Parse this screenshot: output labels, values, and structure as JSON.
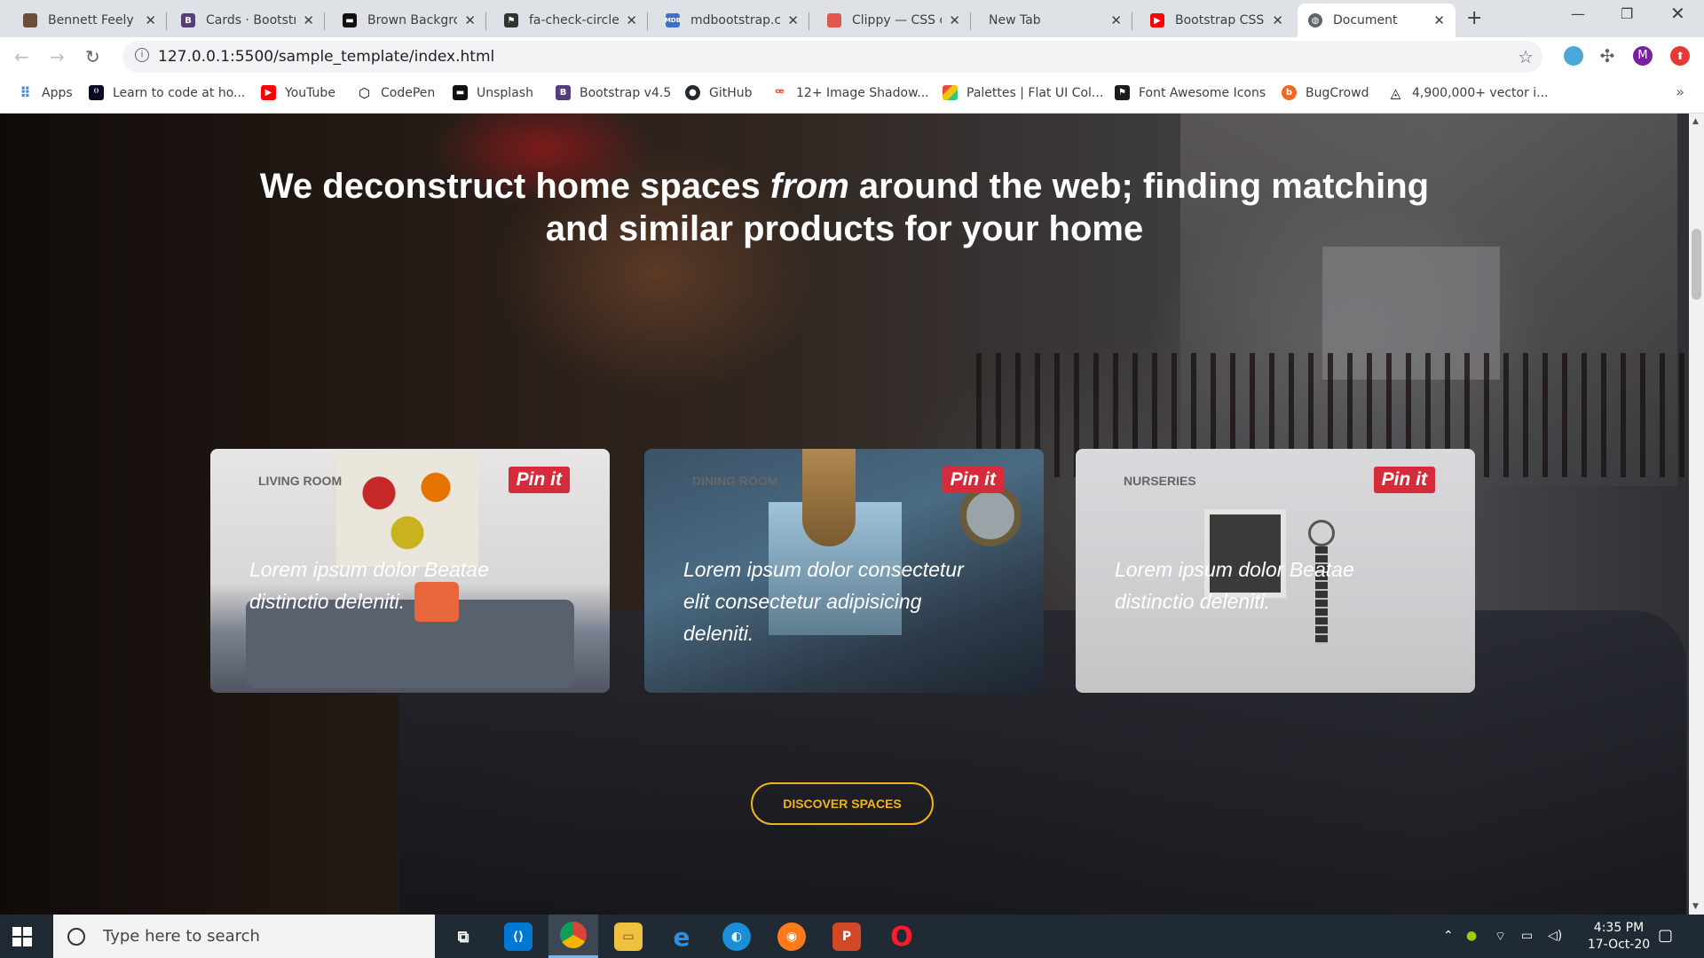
{
  "browser": {
    "tabs": [
      {
        "title": "Bennett Feely",
        "favicon_color": "#6b4f3a"
      },
      {
        "title": "Cards · Bootstra",
        "favicon_color": "#563d7c"
      },
      {
        "title": "Brown Backgro",
        "favicon_color": "#111111"
      },
      {
        "title": "fa-check-circle",
        "favicon_color": "#333333"
      },
      {
        "title": "mdbootstrap.co",
        "favicon_color": "#3b71ca"
      },
      {
        "title": "Clippy — CSS c",
        "favicon_color": "#e2574c"
      },
      {
        "title": "New Tab",
        "favicon_color": ""
      },
      {
        "title": "Bootstrap CSS",
        "favicon_color": "#ff0000"
      },
      {
        "title": "Document",
        "favicon_color": "#5f6368"
      }
    ],
    "active_tab_index": 8,
    "url": "127.0.0.1:5500/sample_template/index.html",
    "profile_initial": "M",
    "bookmarks": [
      {
        "label": "Apps",
        "icon": "apps-grid-icon",
        "color": "#4285f4"
      },
      {
        "label": "Learn to code at ho...",
        "icon": "freecodecamp-icon",
        "color": "#0a0a23"
      },
      {
        "label": "YouTube",
        "icon": "youtube-icon",
        "color": "#ff0000"
      },
      {
        "label": "CodePen",
        "icon": "codepen-icon",
        "color": "#000000"
      },
      {
        "label": "Unsplash",
        "icon": "unsplash-icon",
        "color": "#111111"
      },
      {
        "label": "Bootstrap v4.5",
        "icon": "bootstrap-icon",
        "color": "#563d7c"
      },
      {
        "label": "GitHub",
        "icon": "github-icon",
        "color": "#24292e"
      },
      {
        "label": "12+ Image Shadow...",
        "icon": "image-shadow-icon",
        "color": "#e44d26"
      },
      {
        "label": "Palettes | Flat UI Col...",
        "icon": "palette-icon",
        "color": "#f1c40f"
      },
      {
        "label": "Font Awesome Icons",
        "icon": "font-awesome-icon",
        "color": "#1c1c1c"
      },
      {
        "label": "BugCrowd",
        "icon": "bugcrowd-icon",
        "color": "#f26822"
      },
      {
        "label": "4,900,000+ vector i...",
        "icon": "vector-icon",
        "color": "#111111"
      }
    ]
  },
  "page": {
    "hero": {
      "line1_a": "We deconstruct home spaces ",
      "line1_em": "from",
      "line1_b": " around the web; finding matching",
      "line2": "and similar products for your home"
    },
    "cards": [
      {
        "category": "LIVING ROOM",
        "pin_label": "Pin it",
        "description": "Lorem ipsum dolor Beatae distinctio deleniti."
      },
      {
        "category": "DINING ROOM",
        "pin_label": "Pin it",
        "description": "Lorem ipsum dolor consectetur elit consectetur adipisicing deleniti."
      },
      {
        "category": "NURSERIES",
        "pin_label": "Pin it",
        "description": "Lorem ipsum dolor Beatae distinctio deleniti."
      }
    ],
    "cta": {
      "label": "DISCOVER SPACES"
    },
    "accent_color": "#f0b320",
    "pin_color": "#d62b3a"
  },
  "taskbar": {
    "search_placeholder": "Type here to search",
    "time": "4:35 PM",
    "date": "17-Oct-20"
  }
}
